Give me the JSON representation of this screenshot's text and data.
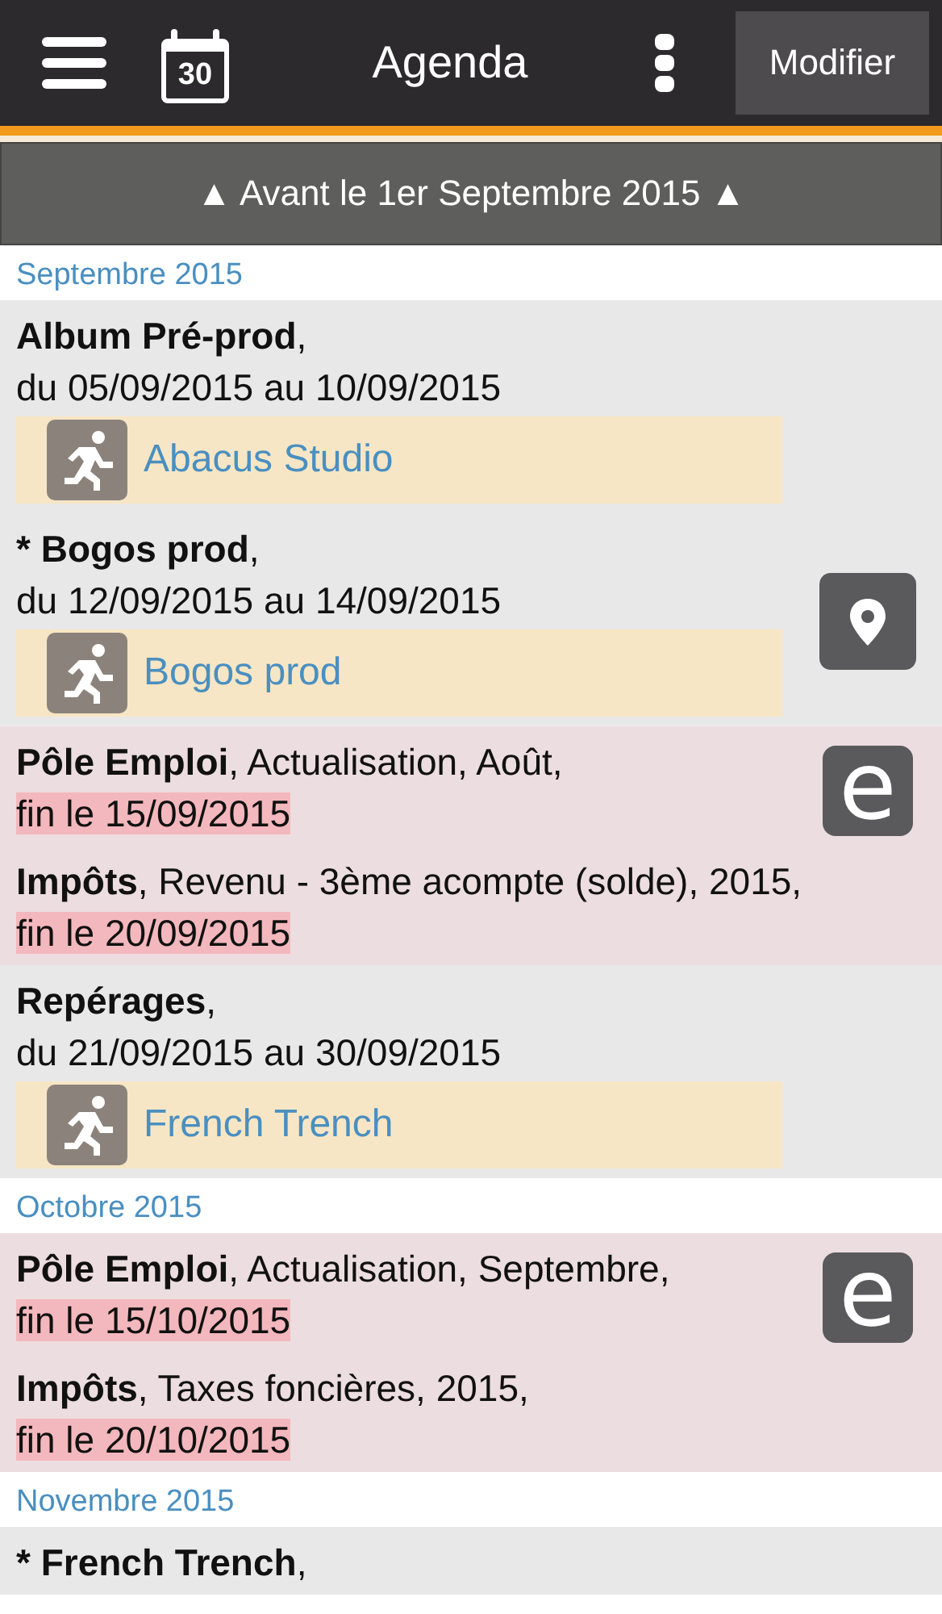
{
  "header": {
    "title": "Agenda",
    "calendar_day": "30",
    "edit_button": "Modifier"
  },
  "earlier_button": "▲ Avant le 1er Septembre 2015 ▲",
  "months": [
    {
      "label": "Septembre 2015",
      "events": [
        {
          "kind": "range",
          "title": "Album Pré-prod",
          "rest": ",",
          "dates": "du 05/09/2015 au 10/09/2015",
          "tag": "Abacus Studio"
        },
        {
          "kind": "range",
          "title": "* Bogos prod",
          "rest": ",",
          "dates": "du 12/09/2015 au 14/09/2015",
          "tag": "Bogos prod",
          "side": {
            "kind": "pin"
          }
        },
        {
          "kind": "deadline",
          "title": "Pôle Emploi",
          "rest": ", Actualisation, Août,",
          "dates": "fin le 15/09/2015",
          "side": {
            "kind": "letter",
            "text": "e"
          }
        },
        {
          "kind": "deadline",
          "title": "Impôts",
          "rest": ", Revenu - 3ème acompte (solde), 2015,",
          "dates": "fin le 20/09/2015"
        },
        {
          "kind": "range",
          "title": "Repérages",
          "rest": ",",
          "dates": "du 21/09/2015 au 30/09/2015",
          "tag": "French Trench"
        }
      ]
    },
    {
      "label": "Octobre 2015",
      "events": [
        {
          "kind": "deadline",
          "title": "Pôle Emploi",
          "rest": ", Actualisation, Septembre,",
          "dates": "fin le 15/10/2015",
          "side": {
            "kind": "letter",
            "text": "e"
          }
        },
        {
          "kind": "deadline",
          "title": "Impôts",
          "rest": ", Taxes foncières, 2015,",
          "dates": "fin le 20/10/2015"
        }
      ]
    },
    {
      "label": "Novembre 2015",
      "events": [
        {
          "kind": "range",
          "title": "* French Trench",
          "rest": ","
        }
      ]
    }
  ]
}
